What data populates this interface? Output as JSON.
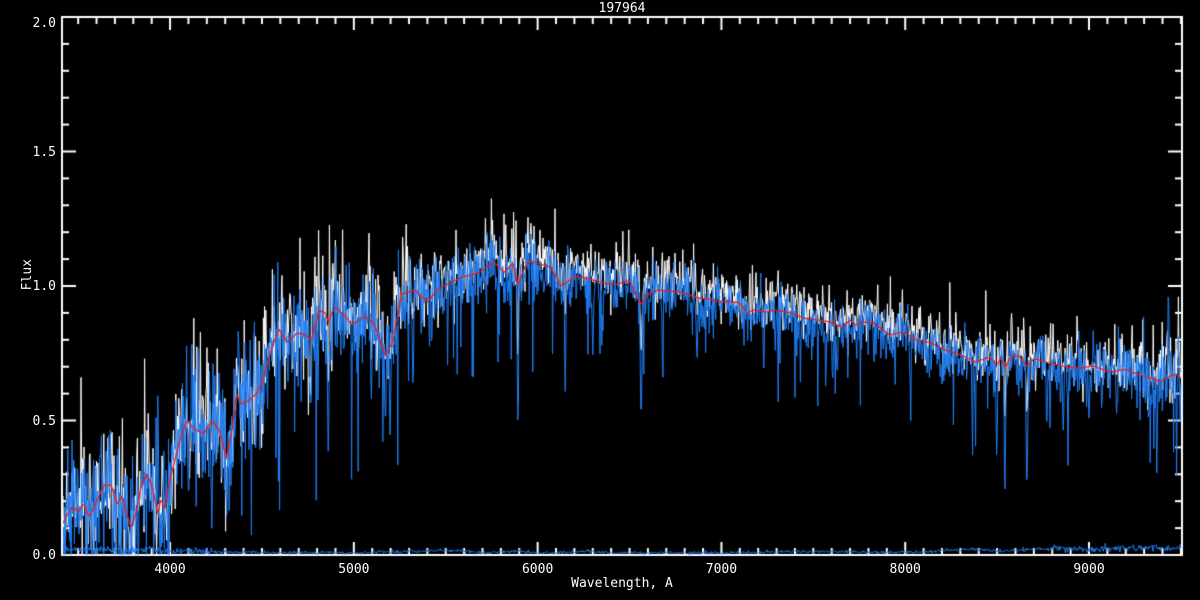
{
  "chart_data": {
    "type": "line",
    "title": "197964",
    "xlabel": "Wavelength, A",
    "ylabel": "Flux",
    "xlim": [
      3412,
      9506
    ],
    "ylim": [
      0.0,
      2.0
    ],
    "grid": false,
    "legend": "none",
    "background": "#000000",
    "axis_color": "#ffffff",
    "x_ticks": [
      {
        "label": "4000",
        "value": 4000
      },
      {
        "label": "5000",
        "value": 5000
      },
      {
        "label": "6000",
        "value": 6000
      },
      {
        "label": "7000",
        "value": 7000
      },
      {
        "label": "8000",
        "value": 8000
      },
      {
        "label": "9000",
        "value": 9000
      }
    ],
    "y_ticks": [
      {
        "label": "0.0",
        "value": 0.0
      },
      {
        "label": "0.5",
        "value": 0.5
      },
      {
        "label": "1.0",
        "value": 1.0
      },
      {
        "label": "1.5",
        "value": 1.5
      },
      {
        "label": "2.0",
        "value": 2.0
      }
    ],
    "x_minor_step": 100,
    "y_minor_step": 0.1,
    "series": [
      {
        "name": "observed-spectrum",
        "color": "#ffffff",
        "style": "noisy",
        "gain": 1.035,
        "noise_scale": 0.85
      },
      {
        "name": "comparison-spectrum",
        "color": "#1f7df2",
        "style": "noisy",
        "gain": 0.99,
        "noise_scale": 1.0
      },
      {
        "name": "error-spectrum",
        "color": "#1f7df2",
        "style": "baseline"
      },
      {
        "name": "template-fit",
        "color": "#e81e1e",
        "style": "smooth"
      }
    ],
    "template_points": [
      [
        3412,
        0.11
      ],
      [
        3440,
        0.15
      ],
      [
        3470,
        0.18
      ],
      [
        3500,
        0.16
      ],
      [
        3530,
        0.19
      ],
      [
        3560,
        0.14
      ],
      [
        3600,
        0.2
      ],
      [
        3640,
        0.26
      ],
      [
        3680,
        0.26
      ],
      [
        3710,
        0.19
      ],
      [
        3740,
        0.22
      ],
      [
        3765,
        0.15
      ],
      [
        3790,
        0.1
      ],
      [
        3815,
        0.16
      ],
      [
        3845,
        0.26
      ],
      [
        3875,
        0.3
      ],
      [
        3905,
        0.25
      ],
      [
        3934,
        0.15
      ],
      [
        3950,
        0.21
      ],
      [
        3970,
        0.17
      ],
      [
        4000,
        0.28
      ],
      [
        4050,
        0.42
      ],
      [
        4090,
        0.5
      ],
      [
        4130,
        0.47
      ],
      [
        4180,
        0.45
      ],
      [
        4230,
        0.5
      ],
      [
        4270,
        0.46
      ],
      [
        4308,
        0.36
      ],
      [
        4340,
        0.48
      ],
      [
        4360,
        0.6
      ],
      [
        4390,
        0.56
      ],
      [
        4430,
        0.575
      ],
      [
        4470,
        0.6
      ],
      [
        4500,
        0.64
      ],
      [
        4550,
        0.76
      ],
      [
        4590,
        0.84
      ],
      [
        4640,
        0.79
      ],
      [
        4690,
        0.825
      ],
      [
        4730,
        0.82
      ],
      [
        4770,
        0.8
      ],
      [
        4810,
        0.91
      ],
      [
        4845,
        0.9
      ],
      [
        4861,
        0.865
      ],
      [
        4880,
        0.9
      ],
      [
        4900,
        0.92
      ],
      [
        4950,
        0.89
      ],
      [
        4990,
        0.855
      ],
      [
        5060,
        0.89
      ],
      [
        5110,
        0.86
      ],
      [
        5170,
        0.74
      ],
      [
        5210,
        0.79
      ],
      [
        5260,
        0.97
      ],
      [
        5330,
        0.985
      ],
      [
        5400,
        0.94
      ],
      [
        5460,
        0.99
      ],
      [
        5520,
        1.01
      ],
      [
        5580,
        1.03
      ],
      [
        5680,
        1.05
      ],
      [
        5760,
        1.09
      ],
      [
        5820,
        1.05
      ],
      [
        5865,
        1.085
      ],
      [
        5893,
        1.0
      ],
      [
        5930,
        1.07
      ],
      [
        5960,
        1.095
      ],
      [
        6020,
        1.08
      ],
      [
        6070,
        1.07
      ],
      [
        6130,
        1.0
      ],
      [
        6200,
        1.035
      ],
      [
        6260,
        1.03
      ],
      [
        6340,
        1.015
      ],
      [
        6420,
        1.005
      ],
      [
        6500,
        1.02
      ],
      [
        6563,
        0.93
      ],
      [
        6610,
        0.975
      ],
      [
        6660,
        0.985
      ],
      [
        6720,
        0.98
      ],
      [
        6770,
        0.978
      ],
      [
        6830,
        0.965
      ],
      [
        6880,
        0.955
      ],
      [
        6940,
        0.95
      ],
      [
        6990,
        0.94
      ],
      [
        7050,
        0.942
      ],
      [
        7100,
        0.937
      ],
      [
        7140,
        0.9
      ],
      [
        7180,
        0.911
      ],
      [
        7240,
        0.903
      ],
      [
        7300,
        0.911
      ],
      [
        7375,
        0.9
      ],
      [
        7455,
        0.88
      ],
      [
        7520,
        0.874
      ],
      [
        7590,
        0.866
      ],
      [
        7660,
        0.845
      ],
      [
        7700,
        0.874
      ],
      [
        7730,
        0.855
      ],
      [
        7780,
        0.866
      ],
      [
        7830,
        0.862
      ],
      [
        7863,
        0.845
      ],
      [
        7915,
        0.818
      ],
      [
        7990,
        0.83
      ],
      [
        8060,
        0.8
      ],
      [
        8135,
        0.79
      ],
      [
        8217,
        0.762
      ],
      [
        8298,
        0.745
      ],
      [
        8380,
        0.718
      ],
      [
        8460,
        0.735
      ],
      [
        8500,
        0.705
      ],
      [
        8520,
        0.735
      ],
      [
        8545,
        0.695
      ],
      [
        8575,
        0.74
      ],
      [
        8620,
        0.74
      ],
      [
        8662,
        0.7
      ],
      [
        8700,
        0.73
      ],
      [
        8790,
        0.713
      ],
      [
        8870,
        0.7
      ],
      [
        8951,
        0.695
      ],
      [
        9020,
        0.703
      ],
      [
        9114,
        0.68
      ],
      [
        9200,
        0.69
      ],
      [
        9278,
        0.668
      ],
      [
        9340,
        0.655
      ],
      [
        9390,
        0.645
      ],
      [
        9460,
        0.672
      ],
      [
        9506,
        0.66
      ]
    ],
    "absorption_lines": [
      [
        4101,
        0.18
      ],
      [
        4227,
        0.08
      ],
      [
        4308,
        0.12
      ],
      [
        4340,
        0.28
      ],
      [
        4861,
        0.33
      ],
      [
        5095,
        0.55
      ],
      [
        5172,
        0.44
      ],
      [
        5197,
        0.43
      ],
      [
        5322,
        0.57
      ],
      [
        5893,
        0.42
      ],
      [
        6150,
        0.6
      ],
      [
        6300,
        0.74
      ],
      [
        6563,
        0.44
      ],
      [
        6867,
        0.7
      ],
      [
        7230,
        0.68
      ],
      [
        7605,
        0.61
      ],
      [
        7630,
        0.63
      ],
      [
        8026,
        0.62
      ],
      [
        8200,
        0.61
      ],
      [
        8380,
        0.55
      ],
      [
        8498,
        0.34
      ],
      [
        8542,
        0.19
      ],
      [
        8662,
        0.19
      ],
      [
        8770,
        0.45
      ],
      [
        8860,
        0.45
      ],
      [
        9000,
        0.48
      ],
      [
        9070,
        0.52
      ],
      [
        9150,
        0.5
      ],
      [
        9340,
        0.55
      ]
    ],
    "emission_spikes": [
      [
        9432,
        0.93
      ]
    ],
    "noise_sigma_points": [
      [
        3412,
        0.12
      ],
      [
        3800,
        0.13
      ],
      [
        4100,
        0.12
      ],
      [
        4400,
        0.12
      ],
      [
        4700,
        0.115
      ],
      [
        5000,
        0.1
      ],
      [
        5300,
        0.085
      ],
      [
        5600,
        0.07
      ],
      [
        5900,
        0.062
      ],
      [
        6200,
        0.058
      ],
      [
        6600,
        0.052
      ],
      [
        7000,
        0.052
      ],
      [
        7400,
        0.05
      ],
      [
        7800,
        0.048
      ],
      [
        8200,
        0.05
      ],
      [
        8600,
        0.055
      ],
      [
        9000,
        0.06
      ],
      [
        9300,
        0.068
      ],
      [
        9506,
        0.082
      ]
    ],
    "error_points": [
      [
        3412,
        0.022
      ],
      [
        3600,
        0.02
      ],
      [
        3800,
        0.018
      ],
      [
        4000,
        0.015
      ],
      [
        4300,
        0.01
      ],
      [
        5000,
        0.008
      ],
      [
        5577,
        0.018
      ],
      [
        5700,
        0.008
      ],
      [
        5893,
        0.014
      ],
      [
        6000,
        0.008
      ],
      [
        6300,
        0.014
      ],
      [
        6400,
        0.008
      ],
      [
        7000,
        0.008
      ],
      [
        7600,
        0.014
      ],
      [
        7800,
        0.01
      ],
      [
        8100,
        0.012
      ],
      [
        8344,
        0.022
      ],
      [
        8500,
        0.015
      ],
      [
        8827,
        0.025
      ],
      [
        9000,
        0.02
      ],
      [
        9200,
        0.025
      ],
      [
        9400,
        0.028
      ],
      [
        9506,
        0.03
      ]
    ]
  }
}
